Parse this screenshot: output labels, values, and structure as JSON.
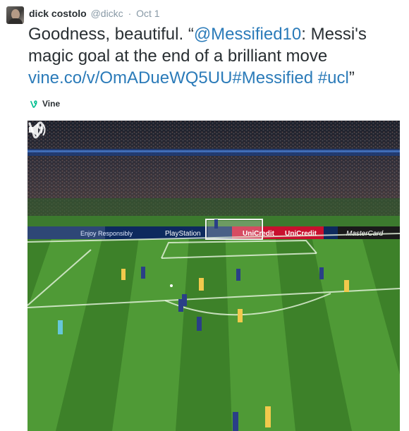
{
  "tweet": {
    "author_name": "dick costolo",
    "handle": "@dickc",
    "separator": "·",
    "time": "Oct 1",
    "text_line1_plain": "Goodness, beautiful. “",
    "mention": "@Messified10",
    "text_line1_rest": ": Messi's",
    "text_line2": "magic goal at the end of a brilliant move",
    "link_url": "vine.co/v/OmADueWQ5UU",
    "hashtag1": "#Messified",
    "space": " ",
    "hashtag2": "#ucl",
    "closing_quote": "”"
  },
  "card": {
    "source_label": "Vine"
  },
  "video": {
    "banner_texts": [
      "Enjoy Responsibly",
      "PlayStation",
      "UniCredit",
      "UniCredit",
      "MasterCard"
    ],
    "icons": [
      "volume-icon",
      "vine-logo-icon"
    ],
    "colors": {
      "pitch_light": "#4f9a36",
      "pitch_dark": "#3d8129",
      "crowd": "#2a2f3a",
      "line": "#e8f5e0",
      "link_blue": "#2b7bb9"
    }
  }
}
